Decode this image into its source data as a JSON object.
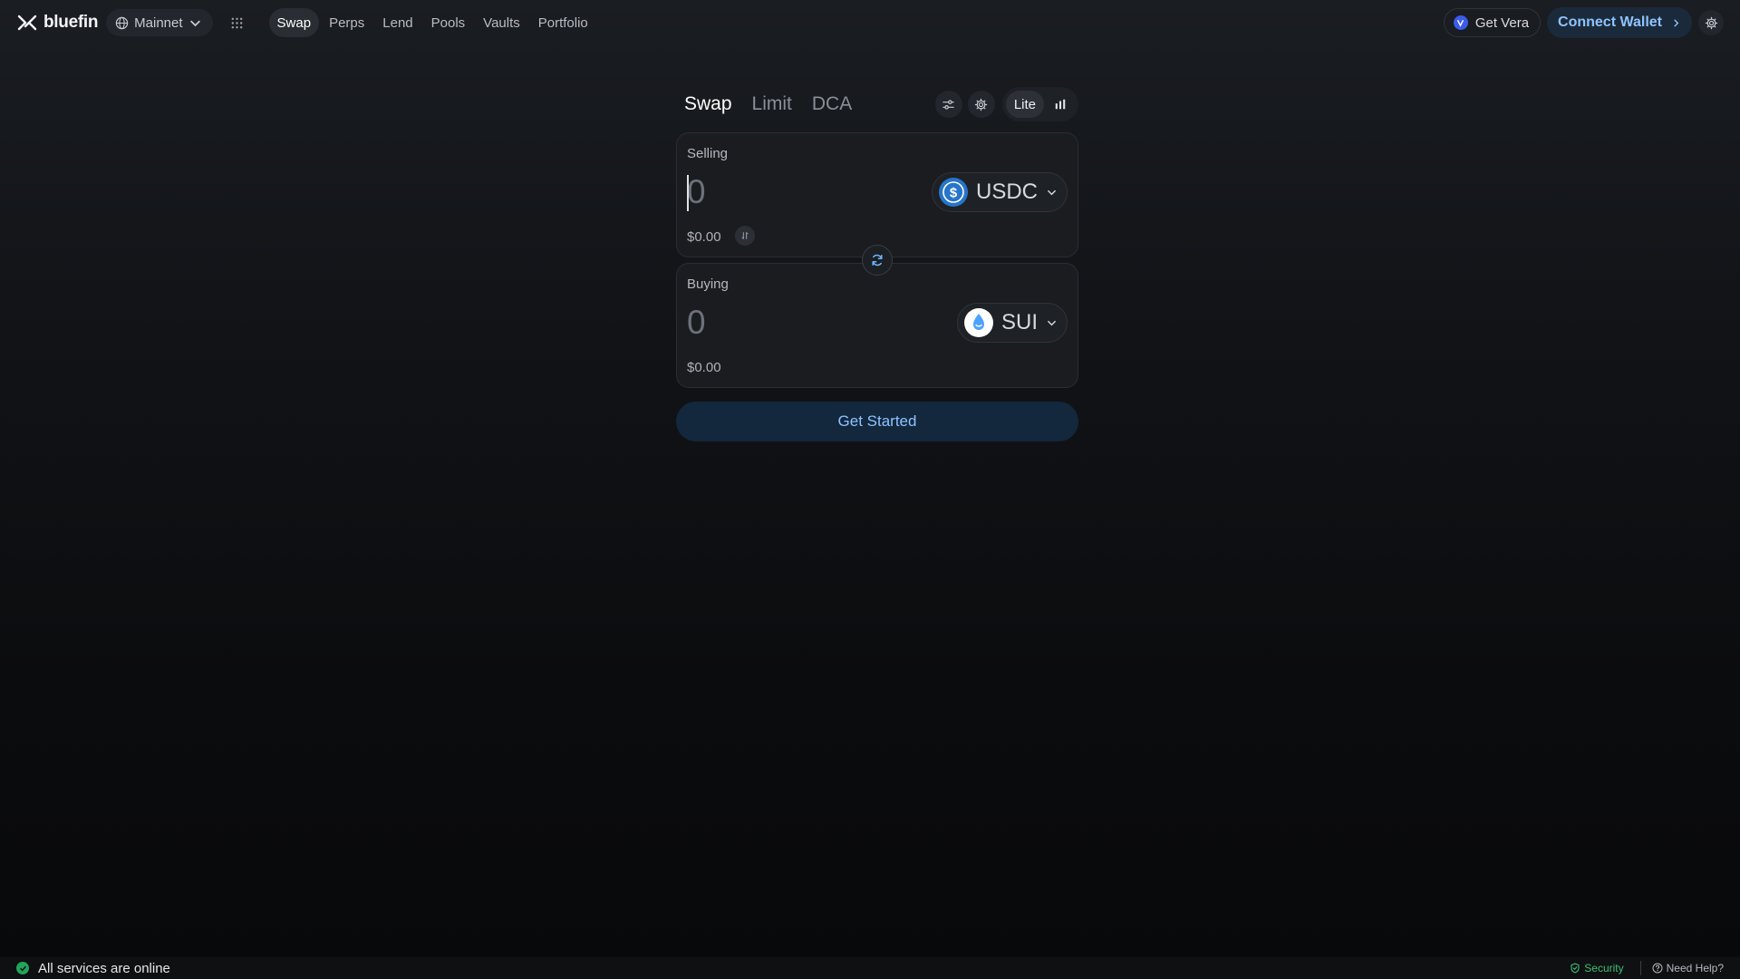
{
  "brand": {
    "name": "bluefin"
  },
  "network": {
    "label": "Mainnet"
  },
  "nav": {
    "items": [
      "Swap",
      "Perps",
      "Lend",
      "Pools",
      "Vaults",
      "Portfolio"
    ],
    "active": "Swap"
  },
  "header_right": {
    "vera_label": "Get Vera",
    "connect_label": "Connect Wallet"
  },
  "swap": {
    "tabs": [
      "Swap",
      "Limit",
      "DCA"
    ],
    "active_tab": "Swap",
    "mode_label": "Lite",
    "sell": {
      "label": "Selling",
      "amount": "0",
      "usd": "$0.00",
      "token": "USDC"
    },
    "buy": {
      "label": "Buying",
      "amount": "0",
      "usd": "$0.00",
      "token": "SUI"
    },
    "cta_label": "Get Started"
  },
  "footer": {
    "status": "All services are online",
    "security": "Security",
    "help": "Need Help?"
  },
  "colors": {
    "accent": "#8fc3ff",
    "success": "#22a35a",
    "usdc": "#2775ca"
  }
}
